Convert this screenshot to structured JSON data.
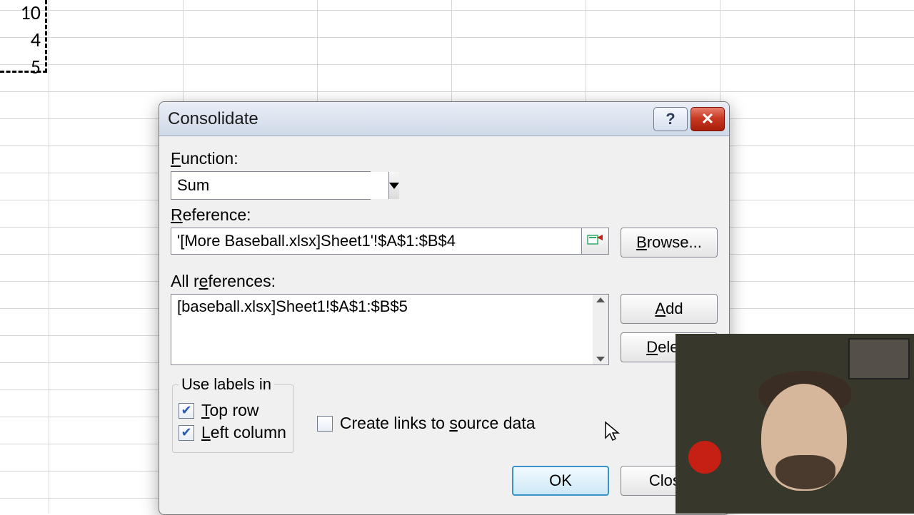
{
  "sheet": {
    "cells": [
      "10",
      "4",
      "5"
    ]
  },
  "dialog": {
    "title": "Consolidate",
    "function_label": "Function:",
    "function_value": "Sum",
    "reference_label": "Reference:",
    "reference_value": "'[More Baseball.xlsx]Sheet1'!$A$1:$B$4",
    "browse": "Browse...",
    "allrefs_label": "All references:",
    "allrefs_item": "[baseball.xlsx]Sheet1!$A$1:$B$5",
    "add": "Add",
    "delete": "Delete",
    "uselabels_legend": "Use labels in",
    "toprow": "Top row",
    "leftcol": "Left column",
    "createlinks": "Create links to source data",
    "ok": "OK",
    "close": "Close"
  }
}
